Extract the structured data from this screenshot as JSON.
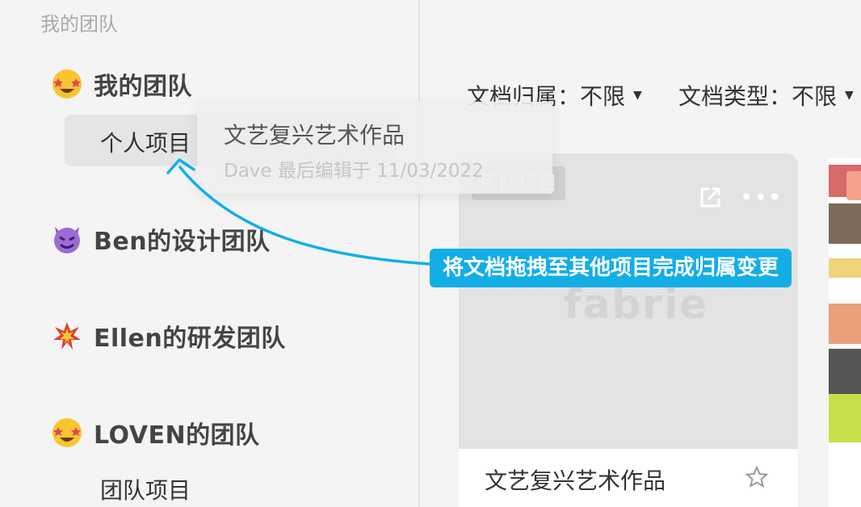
{
  "sidebar": {
    "header": "我的团队",
    "teams": [
      {
        "name": "我的团队",
        "icon": "star-struck-emoji-icon"
      },
      {
        "name": "Ben的设计团队",
        "icon": "smiling-devil-emoji-icon"
      },
      {
        "name": "Ellen的研发团队",
        "icon": "collision-emoji-icon"
      },
      {
        "name": "LOVEN的团队",
        "icon": "star-struck-emoji-icon"
      }
    ],
    "projects": [
      "个人项目",
      "团队项目"
    ]
  },
  "drag_ghost": {
    "title": "文艺复兴艺术作品",
    "meta": "Dave 最后编辑于 11/03/2022"
  },
  "filters": [
    {
      "label": "文档归属：不限"
    },
    {
      "label": "文档类型：不限"
    }
  ],
  "card": {
    "badge": "团队项目",
    "watermark": "fabrie",
    "title": "文艺复兴艺术作品"
  },
  "tooltip": "将文档拖拽至其他项目完成归属变更",
  "colors": {
    "accent": "#13aee6",
    "sidebar_bg": "#f4f4f4",
    "selected_bg": "#e5e5e5"
  }
}
